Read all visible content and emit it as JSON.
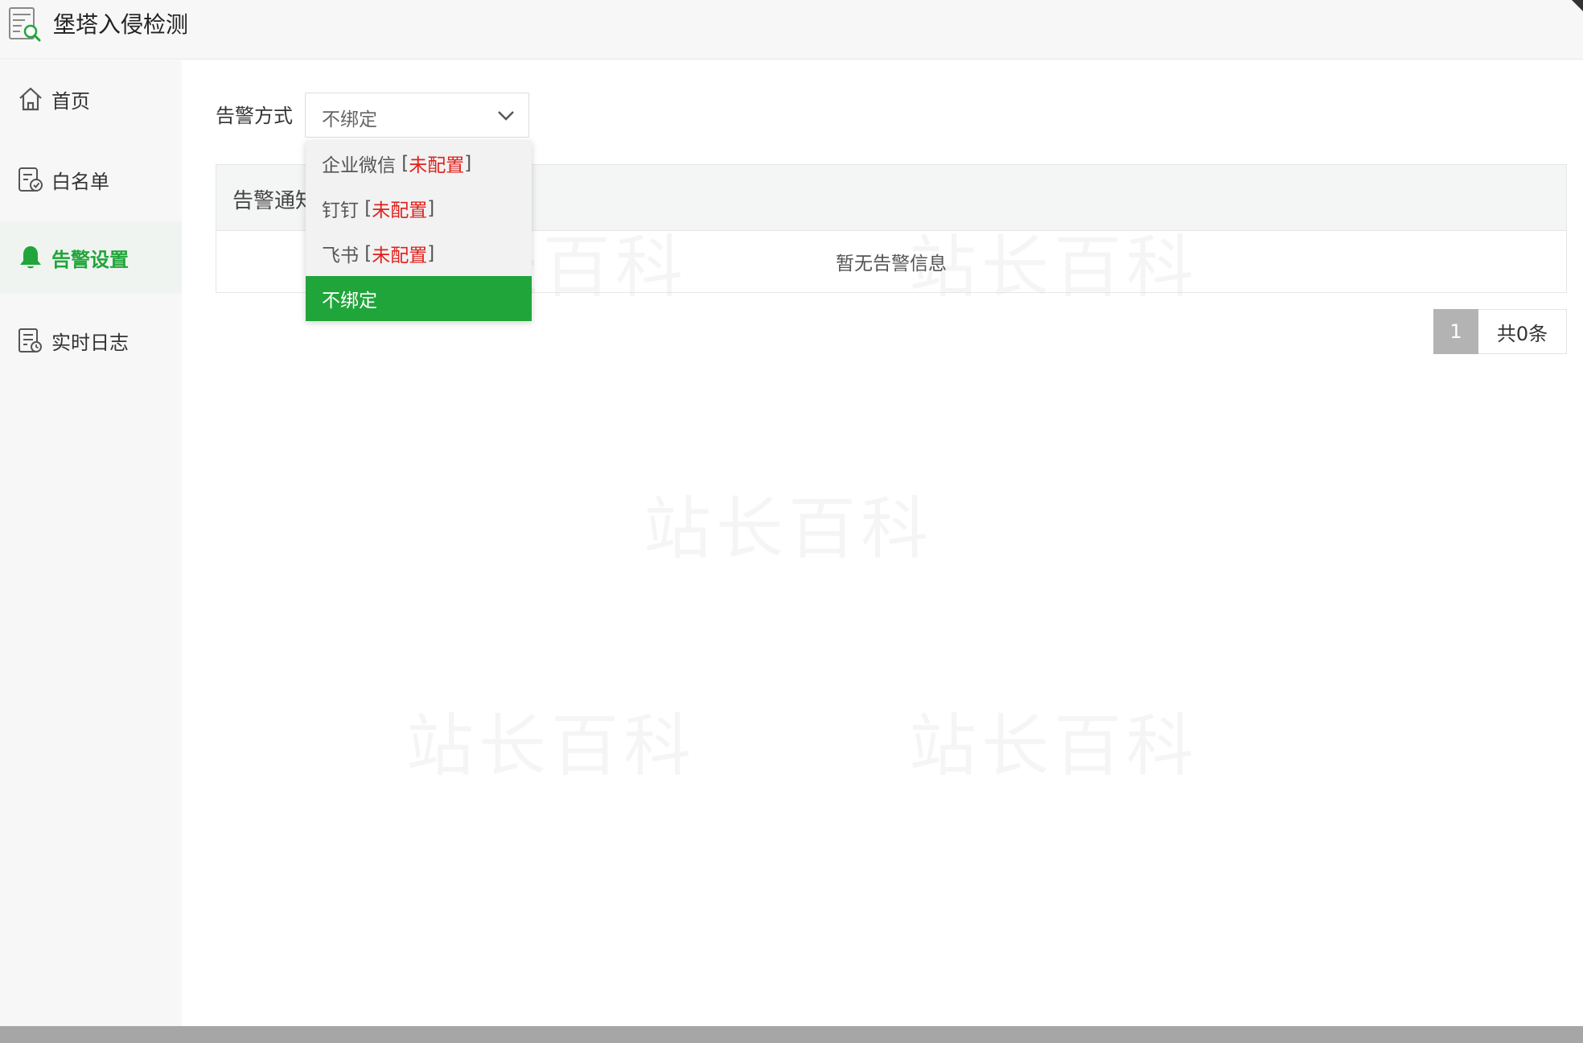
{
  "app": {
    "title": "堡塔入侵检测"
  },
  "sidebar": {
    "items": [
      {
        "label": "首页",
        "icon": "home-icon",
        "active": false
      },
      {
        "label": "白名单",
        "icon": "whitelist-icon",
        "active": false
      },
      {
        "label": "告警设置",
        "icon": "bell-icon",
        "active": true
      },
      {
        "label": "实时日志",
        "icon": "log-icon",
        "active": false
      }
    ]
  },
  "alert_form": {
    "label": "告警方式",
    "selected_value": "不绑定"
  },
  "dropdown": {
    "options": [
      {
        "name": "企业微信",
        "status": "未配置"
      },
      {
        "name": "钉钉",
        "status": "未配置"
      },
      {
        "name": "飞书",
        "status": "未配置"
      },
      {
        "name": "不绑定",
        "status": ""
      }
    ],
    "selected_index": 3
  },
  "table": {
    "header": "告警通知",
    "empty_text": "暂无告警信息"
  },
  "pagination": {
    "current_page": "1",
    "total_text": "共0条"
  },
  "watermark_text": "站长百科",
  "colors": {
    "accent": "#20a53a",
    "warning": "#e0201c",
    "sidebar_bg": "#f7f7f7"
  }
}
